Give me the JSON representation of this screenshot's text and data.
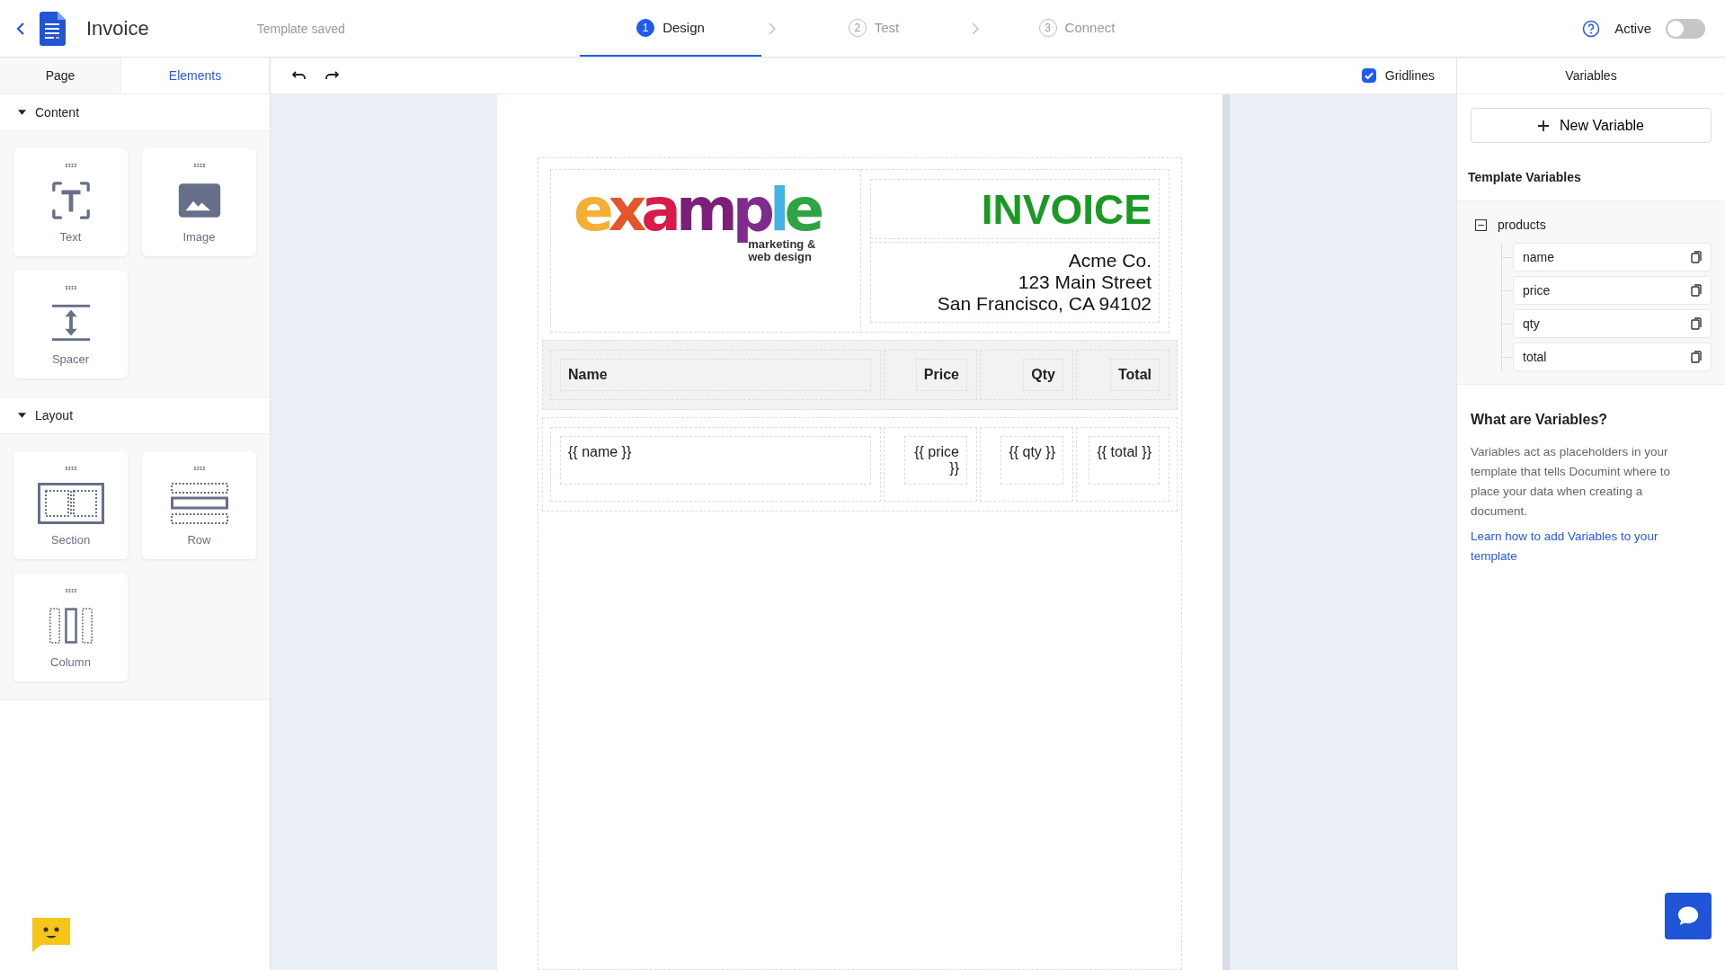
{
  "header": {
    "title": "Invoice",
    "status": "Template saved",
    "steps": [
      {
        "number": "1",
        "label": "Design",
        "selected": true
      },
      {
        "number": "2",
        "label": "Test",
        "selected": false
      },
      {
        "number": "3",
        "label": "Connect",
        "selected": false
      }
    ],
    "active": {
      "label": "Active",
      "on": false
    }
  },
  "left_panel": {
    "tabs": [
      {
        "label": "Page",
        "selected": false
      },
      {
        "label": "Elements",
        "selected": true
      }
    ],
    "sections": [
      {
        "title": "Content",
        "expanded": true,
        "items": [
          {
            "label": "Text",
            "kind": "text"
          },
          {
            "label": "Image",
            "kind": "image"
          },
          {
            "label": "Spacer",
            "kind": "spacer"
          }
        ]
      },
      {
        "title": "Layout",
        "expanded": true,
        "items": [
          {
            "label": "Section",
            "kind": "section"
          },
          {
            "label": "Row",
            "kind": "row"
          },
          {
            "label": "Column",
            "kind": "column"
          }
        ]
      }
    ]
  },
  "toolbar": {
    "gridlines": {
      "label": "Gridlines",
      "checked": true
    }
  },
  "document": {
    "logo": {
      "word": "example",
      "tagline": [
        "marketing &",
        "web design"
      ]
    },
    "title": "INVOICE",
    "address": [
      "Acme Co.",
      "123 Main Street",
      "San Francisco, CA 94102"
    ],
    "table": {
      "columns": [
        "Name",
        "Price",
        "Qty",
        "Total"
      ],
      "rows": [
        [
          "{{ name }}",
          "{{ price }}",
          "{{ qty }}",
          "{{ total }}"
        ]
      ]
    }
  },
  "right_panel": {
    "tab": "Variables",
    "new_variable": "New Variable",
    "heading": "Template Variables",
    "tree": [
      {
        "name": "products",
        "expanded": true,
        "children": [
          {
            "name": "name"
          },
          {
            "name": "price"
          },
          {
            "name": "qty"
          },
          {
            "name": "total"
          }
        ]
      }
    ],
    "help": {
      "title": "What are Variables?",
      "body": "Variables act as placeholders in your template that tells Documint where to place your data when creating a document.",
      "link": "Learn how to add Variables to your template"
    }
  }
}
